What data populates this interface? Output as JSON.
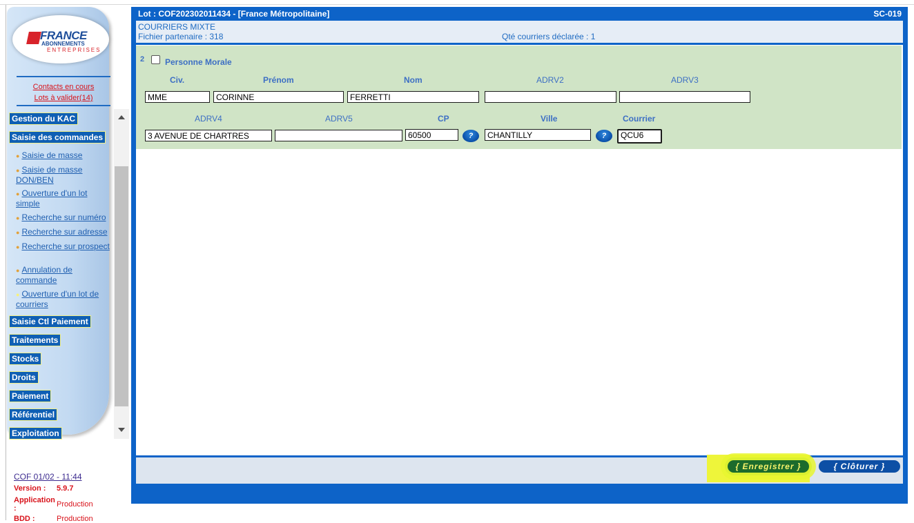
{
  "sidebar": {
    "logo": {
      "line1": "FRANCE",
      "line2": "ABONNEMENTS",
      "line3": "ENTREPRISES"
    },
    "links": {
      "contacts": "Contacts en cours",
      "lots": "Lots à valider(14)"
    },
    "menu": {
      "gestion_kac": "Gestion du KAC",
      "saisie_commandes": "Saisie des commandes",
      "saisie_ctl_paiement": "Saisie Ctl Paiement",
      "traitements": "Traitements",
      "stocks": "Stocks",
      "droits": "Droits",
      "paiement": "Paiement",
      "referentiel": "Référentiel",
      "exploitation": "Exploitation"
    },
    "submenu": [
      "Saisie de masse",
      "Saisie de masse DON/BEN",
      "Ouverture d'un lot simple",
      "Recherche sur numéro",
      "Recherche sur adresse",
      "Recherche sur prospect",
      "Annulation de commande",
      "Ouverture d'un lot de courriers"
    ],
    "footer": {
      "session": "COF 01/02 - 11:44",
      "version_label": "Version :",
      "version_value": "5.9.7",
      "application_label": "Application :",
      "application_value": "Production",
      "bdd_label": "BDD :",
      "bdd_value": "Production"
    }
  },
  "header": {
    "title": "Lot : COF202302011434 - [France Métropolitaine]",
    "code": "SC-019"
  },
  "info": {
    "type": "COURRIERS MIXTE",
    "fichier": "Fichier partenaire : 318",
    "qte": "Qté courriers déclarée : 1"
  },
  "form": {
    "row_number": "2",
    "personne_morale_label": "Personne Morale",
    "labels": {
      "civ": "Civ.",
      "prenom": "Prénom",
      "nom": "Nom",
      "adrv2": "ADRV2",
      "adrv3": "ADRV3",
      "adrv4": "ADRV4",
      "adrv5": "ADRV5",
      "cp": "CP",
      "ville": "Ville",
      "courrier": "Courrier"
    },
    "values": {
      "civ": "MME",
      "prenom": "CORINNE",
      "nom": "FERRETTI",
      "adrv2": "",
      "adrv3": "",
      "adrv4": "3 AVENUE DE CHARTRES",
      "adrv5": "",
      "cp": "60500",
      "ville": "CHANTILLY",
      "courrier": "QCU6"
    },
    "help_glyph": "?"
  },
  "buttons": {
    "save": "{ Enregistrer }",
    "close": "{ Clôturer }"
  },
  "colors": {
    "primary": "#0d63c8",
    "form_bg": "#d0e4c6",
    "save_bg": "#1c6b2c",
    "highlight": "#eef53a",
    "alert_red": "#d8121a"
  }
}
